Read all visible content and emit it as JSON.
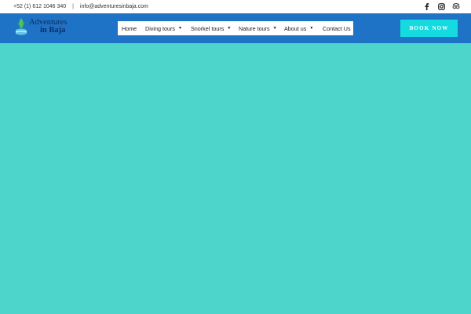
{
  "topbar": {
    "phone": "+52 (1) 612 1046 340",
    "separator": "|",
    "email": "info@adventuresinbaja.com",
    "social_icons": [
      "facebook-icon",
      "instagram-icon",
      "tripadvisor-icon"
    ]
  },
  "logo": {
    "line1": "Adventures",
    "line2": "in Baja"
  },
  "nav": {
    "items": [
      {
        "label": "Home"
      },
      {
        "label": "Diving tours"
      },
      {
        "label": "Snorkel tours"
      },
      {
        "label": "Nature tours"
      },
      {
        "label": "About us"
      },
      {
        "label": "Contact Us"
      }
    ]
  },
  "header": {
    "book_label": "BOOK NOW"
  },
  "colors": {
    "header_bg": "#1f73c6",
    "hero_bg": "#4dd5cc",
    "book_button": "#15dbe0"
  }
}
